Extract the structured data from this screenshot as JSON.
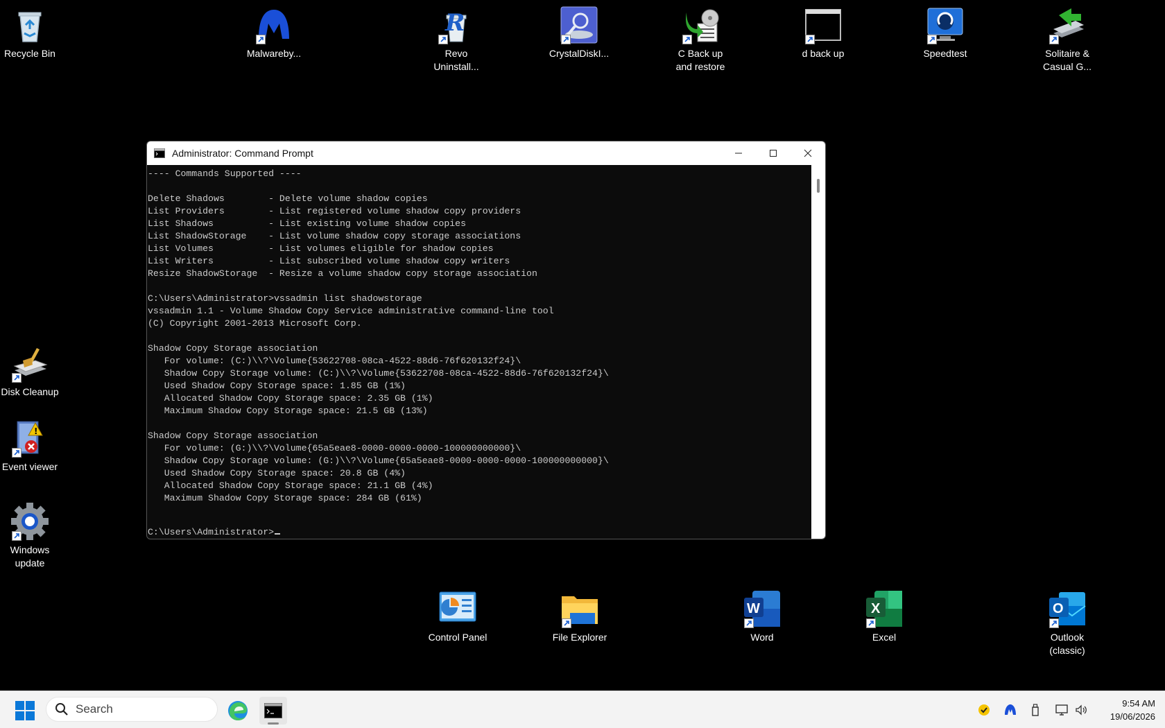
{
  "desktop": {
    "icons": {
      "recycle_bin": "Recycle Bin",
      "malwarebytes": "Malwareby...",
      "revo": "Revo\nUninstall...",
      "crystaldisk": "CrystalDiskI...",
      "c_backup": "C Back up\nand restore",
      "d_backup": "d back up",
      "speedtest": "Speedtest",
      "solitaire": "Solitaire &\nCasual G...",
      "disk_cleanup": "Disk Cleanup",
      "event_viewer": "Event viewer",
      "windows_update": "Windows\nupdate",
      "control_panel": "Control Panel",
      "file_explorer": "File Explorer",
      "word": "Word",
      "excel": "Excel",
      "outlook": "Outlook\n(classic)"
    }
  },
  "cmd": {
    "title": "Administrator: Command Prompt",
    "output": "---- Commands Supported ----\n\nDelete Shadows        - Delete volume shadow copies\nList Providers        - List registered volume shadow copy providers\nList Shadows          - List existing volume shadow copies\nList ShadowStorage    - List volume shadow copy storage associations\nList Volumes          - List volumes eligible for shadow copies\nList Writers          - List subscribed volume shadow copy writers\nResize ShadowStorage  - Resize a volume shadow copy storage association\n\nC:\\Users\\Administrator>vssadmin list shadowstorage\nvssadmin 1.1 - Volume Shadow Copy Service administrative command-line tool\n(C) Copyright 2001-2013 Microsoft Corp.\n\nShadow Copy Storage association\n   For volume: (C:)\\\\?\\Volume{53622708-08ca-4522-88d6-76f620132f24}\\\n   Shadow Copy Storage volume: (C:)\\\\?\\Volume{53622708-08ca-4522-88d6-76f620132f24}\\\n   Used Shadow Copy Storage space: 1.85 GB (1%)\n   Allocated Shadow Copy Storage space: 2.35 GB (1%)\n   Maximum Shadow Copy Storage space: 21.5 GB (13%)\n\nShadow Copy Storage association\n   For volume: (G:)\\\\?\\Volume{65a5eae8-0000-0000-0000-100000000000}\\\n   Shadow Copy Storage volume: (G:)\\\\?\\Volume{65a5eae8-0000-0000-0000-100000000000}\\\n   Used Shadow Copy Storage space: 20.8 GB (4%)\n   Allocated Shadow Copy Storage space: 21.1 GB (4%)\n   Maximum Shadow Copy Storage space: 284 GB (61%)",
    "prompt": "C:\\Users\\Administrator>"
  },
  "taskbar": {
    "search_placeholder": "Search",
    "time": "9:54 AM",
    "date": "19/06/2026"
  }
}
